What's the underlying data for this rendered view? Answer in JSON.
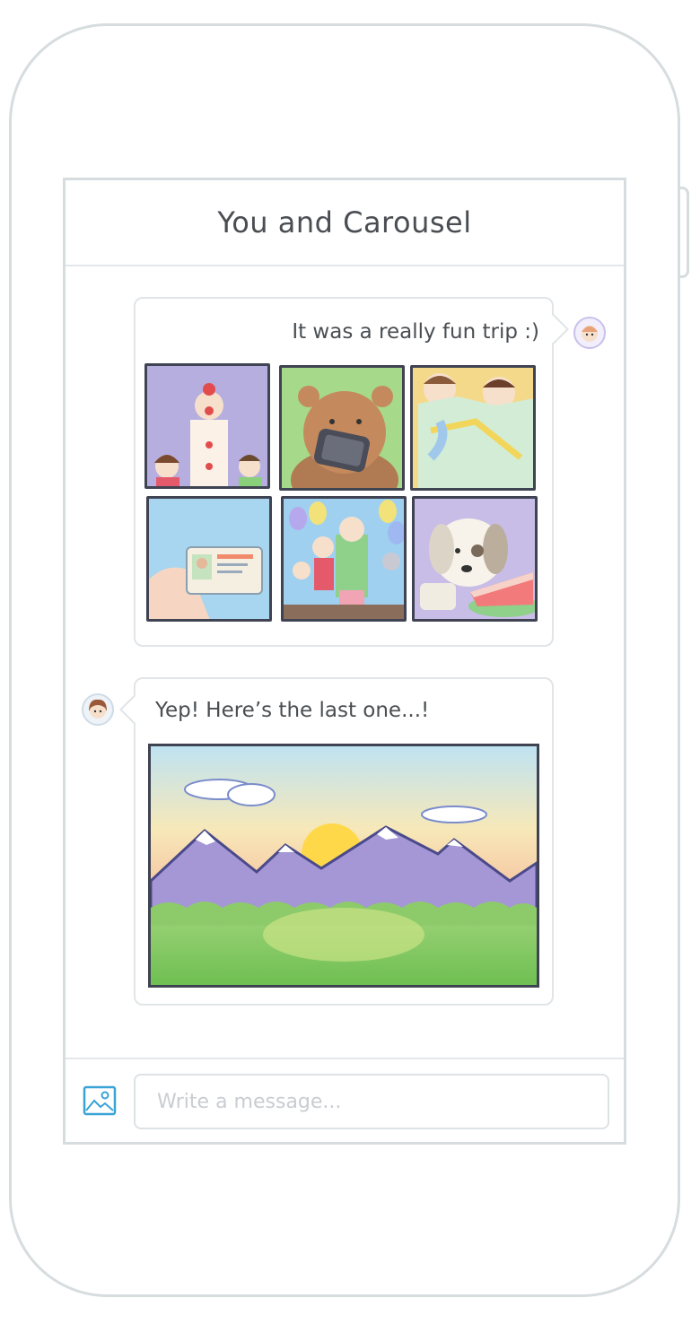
{
  "header": {
    "title": "You and Carousel"
  },
  "messages": [
    {
      "direction": "outgoing",
      "text": "It was a really fun trip :)",
      "photos": [
        "clown-photo",
        "bear-phone-photo",
        "map-photo",
        "id-card-photo",
        "birthday-party-photo",
        "dog-cake-photo"
      ]
    },
    {
      "direction": "incoming",
      "text": "Yep! Here’s the last one...!",
      "photos": [
        "mountain-sunset-photo"
      ]
    }
  ],
  "composer": {
    "placeholder": "Write a message...",
    "attach_icon": "image-icon"
  },
  "colors": {
    "border": "#d7dcdf",
    "text": "#4a4e52",
    "accent": "#3aa3d6"
  }
}
